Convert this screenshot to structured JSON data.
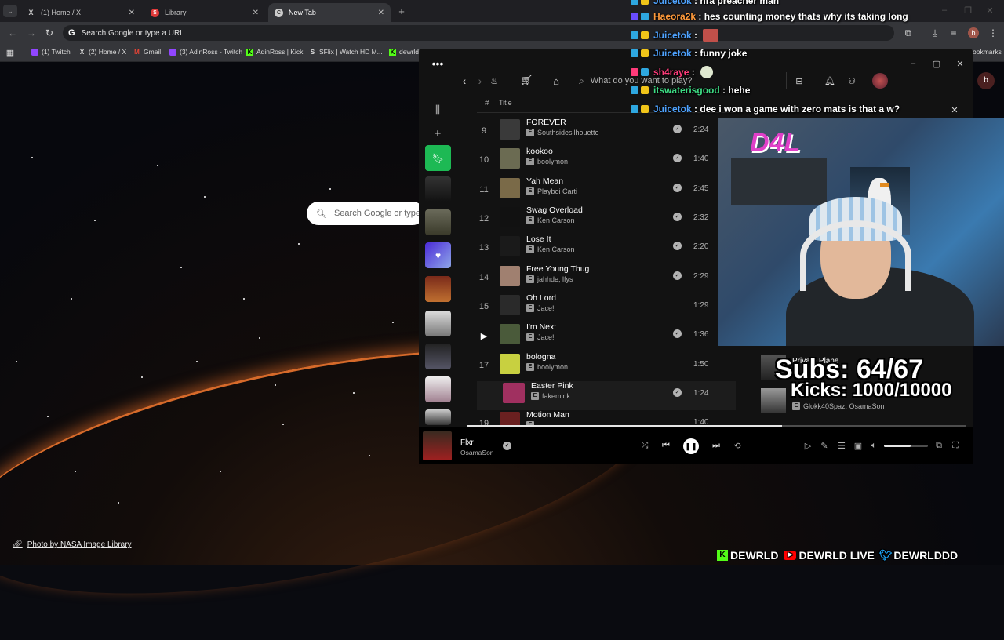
{
  "browser": {
    "tabs": [
      {
        "title": "(1) Home / X",
        "icon": "X"
      },
      {
        "title": "Library",
        "icon": "S"
      },
      {
        "title": "New Tab",
        "icon": "C"
      }
    ],
    "omnibox_placeholder": "Search Google or type a URL",
    "profile_initial": "b",
    "bookmarks": [
      {
        "label": "(1) Twitch",
        "icon": "twitch-icon"
      },
      {
        "label": "(2) Home / X",
        "icon": "x-icon"
      },
      {
        "label": "Gmail",
        "icon": "gmail-icon"
      },
      {
        "label": "(3) AdinRoss - Twitch",
        "icon": "twitch-icon"
      },
      {
        "label": "AdinRoss | Kick",
        "icon": "kick-icon"
      },
      {
        "label": "SFlix | Watch HD M...",
        "icon": "sflix-icon"
      },
      {
        "label": "dewrld",
        "icon": "kick-icon"
      }
    ],
    "bookmarks_overflow": "ookmarks"
  },
  "newtab": {
    "search_placeholder": "Search Google or type",
    "credit": "Photo by NASA Image Library"
  },
  "spotify": {
    "search_placeholder": "What do you want to play?",
    "col_num": "#",
    "col_title": "Title",
    "tracks": [
      {
        "num": "9",
        "title": "FOREVER",
        "artist": "Southsidesilhouette",
        "duration": "2:24",
        "saved": true,
        "color": "#3a3a3a"
      },
      {
        "num": "10",
        "title": "kookoo",
        "artist": "boolymon",
        "duration": "1:40",
        "saved": true,
        "color": "#6b6b52"
      },
      {
        "num": "11",
        "title": "Yah Mean",
        "artist": "Playboi Carti",
        "duration": "2:45",
        "saved": true,
        "color": "#7a6a48"
      },
      {
        "num": "12",
        "title": "Swag Overload",
        "artist": "Ken Carson",
        "duration": "2:32",
        "saved": true,
        "color": "#111111"
      },
      {
        "num": "13",
        "title": "Lose It",
        "artist": "Ken Carson",
        "duration": "2:20",
        "saved": true,
        "color": "#1a1a1a"
      },
      {
        "num": "14",
        "title": "Free Young Thug",
        "artist": "jahhde, lfys",
        "duration": "2:29",
        "saved": true,
        "color": "#a08070"
      },
      {
        "num": "15",
        "title": "Oh Lord",
        "artist": "Jace!",
        "duration": "1:29",
        "saved": false,
        "color": "#2a2a2a"
      },
      {
        "num": "",
        "title": "I'm Next",
        "artist": "Jace!",
        "duration": "1:36",
        "saved": true,
        "color": "#4a5a3a"
      },
      {
        "num": "17",
        "title": "bologna",
        "artist": "boolymon",
        "duration": "1:50",
        "saved": false,
        "color": "#c8d040"
      },
      {
        "num": "",
        "title": "Easter Pink",
        "artist": "fakemink",
        "duration": "1:24",
        "saved": true,
        "color": "#a03060"
      },
      {
        "num": "19",
        "title": "Motion Man",
        "artist": "",
        "duration": "1:40",
        "saved": false,
        "color": "#6a2020"
      }
    ],
    "now_playing": {
      "title": "Flxr",
      "artist": "OsamaSon"
    },
    "progress_fraction": 0.63,
    "volume_fraction": 0.6,
    "extra_overlay_text": "Private Plane",
    "extra_overlay_artist": "Glokk40Spaz, OsamaSon"
  },
  "chat": [
    {
      "user": "Juicetok",
      "msg": "nra preacher man",
      "color": "#4fa3ff"
    },
    {
      "user": "Haeora2k",
      "msg": "hes counting money thats why its taking long",
      "color": "#ff9a3c"
    },
    {
      "user": "Juicetok",
      "msg": "",
      "color": "#4fa3ff"
    },
    {
      "user": "Juicetok",
      "msg": "funny joke",
      "color": "#4fa3ff"
    },
    {
      "user": "sh4raye",
      "msg": "",
      "color": "#ff3b7a"
    },
    {
      "user": "itswaterisgood",
      "msg": "hehe",
      "color": "#3ddc84"
    },
    {
      "user": "Juicetok",
      "msg": "dee i won a game with zero mats is that a w?",
      "color": "#4fa3ff"
    }
  ],
  "stream": {
    "webcam_sign": "D4L",
    "subs": "Subs: 64/67",
    "kicks": "Kicks: 1000/10000",
    "socials": [
      "DEWRLD",
      "DEWRLD LIVE",
      "DEWRLDDD"
    ]
  }
}
